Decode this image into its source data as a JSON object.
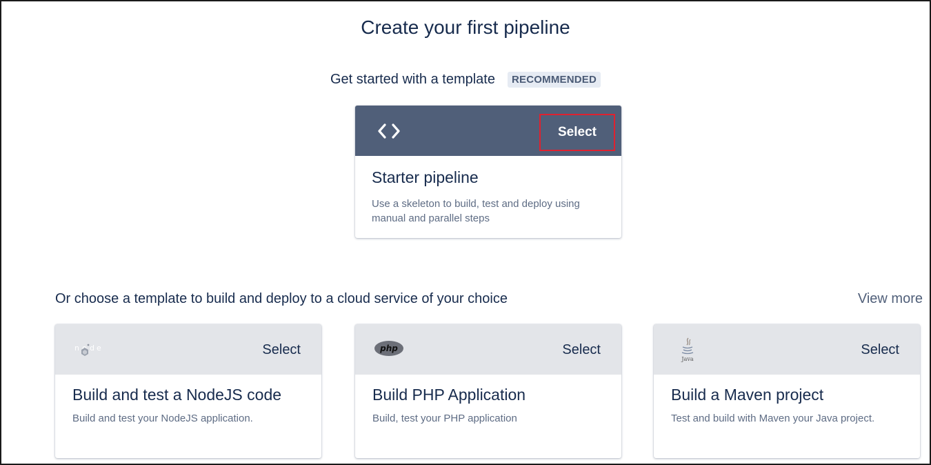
{
  "page": {
    "title": "Create your first pipeline"
  },
  "recommended": {
    "label": "Get started with a template",
    "badge": "RECOMMENDED",
    "card": {
      "icon": "code-icon",
      "select_label": "Select",
      "title": "Starter pipeline",
      "description": "Use a skeleton to build, test and deploy using manual and parallel steps"
    }
  },
  "templates": {
    "label": "Or choose a template to build and deploy to a cloud service of your choice",
    "view_more": "View more",
    "cards": [
      {
        "icon": "nodejs-logo-icon",
        "select_label": "Select",
        "title": "Build and test a NodeJS code",
        "description": "Build and test your NodeJS application."
      },
      {
        "icon": "php-logo-icon",
        "logo_text": "php",
        "select_label": "Select",
        "title": "Build PHP Application",
        "description": "Build, test your PHP application"
      },
      {
        "icon": "java-logo-icon",
        "logo_text": "Java",
        "select_label": "Select",
        "title": "Build a Maven project",
        "description": "Test and build with Maven your Java project."
      }
    ]
  },
  "colors": {
    "header_dark": "#505f79",
    "header_light": "#e3e5e9",
    "highlight_border": "#e0212f",
    "text_primary": "#172b4d",
    "text_secondary": "#5e6c84"
  }
}
